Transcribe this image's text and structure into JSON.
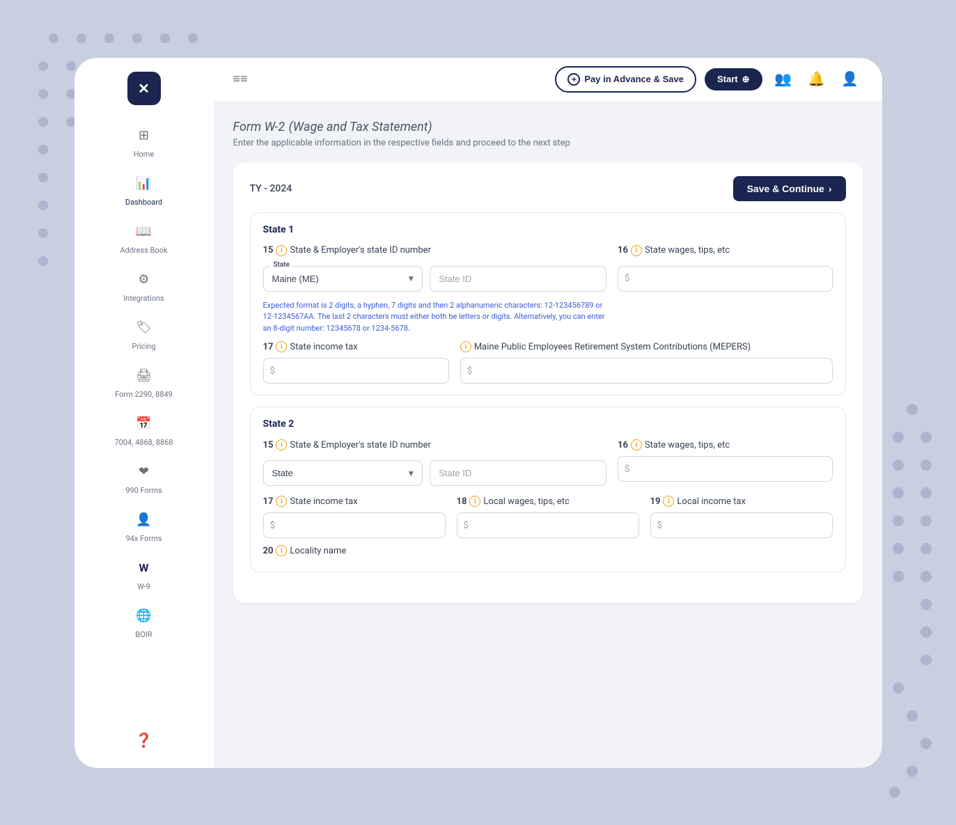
{
  "app": {
    "logo_text": "✕",
    "title": "Form W-2",
    "title_subtitle": "(Wage and Tax Statement)",
    "page_description": "Enter the applicable information in the respective fields and proceed to the next step"
  },
  "header": {
    "menu_icon": "≡",
    "pay_advance_label": "Pay in Advance & Save",
    "start_label": "Start",
    "ty_label": "TY - 2024",
    "save_continue_label": "Save & Continue"
  },
  "sidebar": {
    "items": [
      {
        "id": "home",
        "label": "Home",
        "icon": "⊞"
      },
      {
        "id": "dashboard",
        "label": "Dashboard",
        "icon": "📊"
      },
      {
        "id": "address-book",
        "label": "Address Book",
        "icon": "📖"
      },
      {
        "id": "integrations",
        "label": "Integrations",
        "icon": "⚙"
      },
      {
        "id": "pricing",
        "label": "Pricing",
        "icon": "🏷"
      },
      {
        "id": "form-2290",
        "label": "Form 2290, 8849",
        "icon": "🖨"
      },
      {
        "id": "form-7004",
        "label": "7004, 4868, 8868",
        "icon": "📅"
      },
      {
        "id": "form-990",
        "label": "990 Forms",
        "icon": "❤"
      },
      {
        "id": "form-94x",
        "label": "94x Forms",
        "icon": "👤"
      },
      {
        "id": "form-w9",
        "label": "W-9",
        "icon": "W"
      },
      {
        "id": "form-boir",
        "label": "BOIR",
        "icon": "🌐"
      }
    ],
    "help_icon": "?"
  },
  "state1": {
    "title": "State 1",
    "field15_num": "15",
    "field15_label": "State & Employer's state ID number",
    "state_label": "State",
    "state_value": "Maine (ME)",
    "state_id_placeholder": "State ID",
    "field15_hint": "Expected format is 2 digits, a hyphen, 7 digits and then 2 alphanumeric characters: 12-123456789 or 12-1234567AA. The last 2 characters must either both be letters or digits. Alternatively, you can enter an 8-digit number: 12345678 or 1234-5678.",
    "field16_num": "16",
    "field16_label": "State wages, tips, etc",
    "field16_placeholder": "$",
    "field17_num": "17",
    "field17_label": "State income tax",
    "field17_placeholder": "$",
    "mepers_label": "Maine Public Employees Retirement System Contributions (MEPERS)",
    "mepers_placeholder": "$"
  },
  "state2": {
    "title": "State 2",
    "field15_num": "15",
    "field15_label": "State & Employer's state ID number",
    "state_placeholder": "State",
    "state_id_placeholder": "State ID",
    "field16_num": "16",
    "field16_label": "State wages, tips, etc",
    "field16_placeholder": "$",
    "field17_num": "17",
    "field17_label": "State income tax",
    "field17_placeholder": "$",
    "field18_num": "18",
    "field18_label": "Local wages, tips, etc",
    "field18_placeholder": "$",
    "field19_num": "19",
    "field19_label": "Local income tax",
    "field19_placeholder": "$",
    "field20_num": "20",
    "field20_label": "Locality name"
  }
}
